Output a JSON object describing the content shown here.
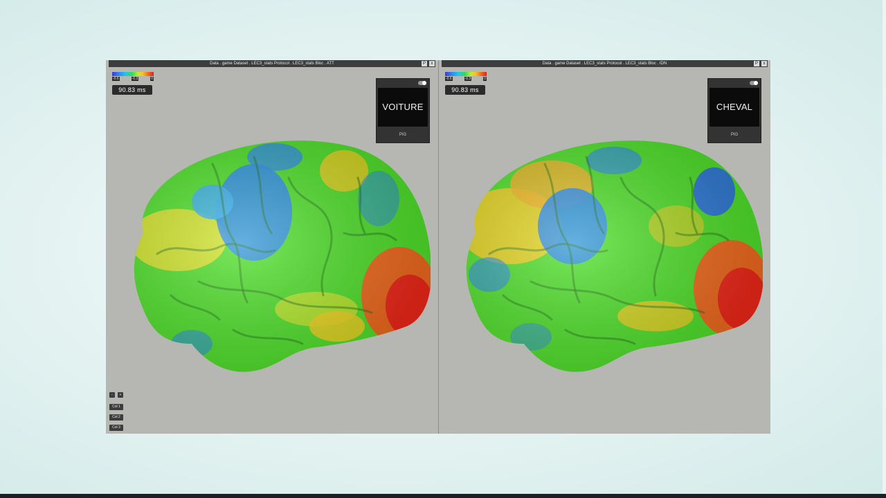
{
  "left_panel": {
    "title": "Data . game Dataset . LEC3_stats Protocol . LEC3_stats Bloc . ATT",
    "colorscale_ticks": [
      "-0.6",
      "-0.3",
      "0"
    ],
    "time_readout": "90.83 ms",
    "stimulus_word": "VOITURE",
    "stimulus_footer": "PIG",
    "controls": {
      "minus": "-",
      "plus": "+",
      "col1": "Col 1",
      "col2": "Col 2",
      "col3": "Col 3"
    }
  },
  "right_panel": {
    "title": "Data . game Dataset . LEC3_stats Protocol . LEC3_stats Bloc . IDN",
    "colorscale_ticks": [
      "-0.6",
      "-0.3",
      "0"
    ],
    "time_readout": "90.83 ms",
    "stimulus_word": "CHEVAL",
    "stimulus_footer": "PIG"
  },
  "titlebar_buttons": {
    "pin": "P",
    "close": "x"
  },
  "colors": {
    "viewer_bg": "#b6b6b2",
    "stim_bg": "#0b0b0b",
    "brain_green": "#4fe02a",
    "brain_blue": "#2d8ee8",
    "brain_red": "#f0281a",
    "brain_yellow": "#f2d21f"
  },
  "icons": [
    "pin-icon",
    "close-icon",
    "toggle-icon"
  ]
}
